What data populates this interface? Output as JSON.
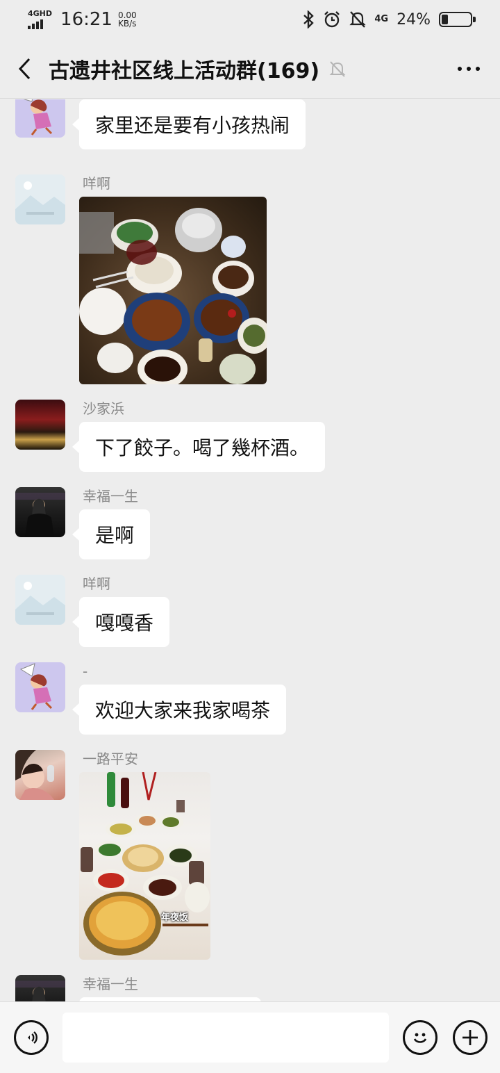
{
  "status_bar": {
    "network": "4GHD",
    "time": "16:21",
    "speed_value": "0.00",
    "speed_unit": "KB/s",
    "cell": "4G",
    "battery_text": "24%",
    "battery_level": 0.24
  },
  "header": {
    "title": "古遗井社区线上活动群(169)"
  },
  "messages": [
    {
      "type": "text",
      "sender": "",
      "text": "家里还是要有小孩热闹",
      "avatar": "cartoon-avatar"
    },
    {
      "type": "image",
      "sender": "咩啊",
      "image": "dinner-table-photo",
      "avatar": "placeholder-avatar"
    },
    {
      "type": "text",
      "sender": "沙家浜",
      "text": "下了餃子。喝了幾杯酒。",
      "avatar": "night-scene-avatar"
    },
    {
      "type": "text",
      "sender": "幸福一生",
      "text": "是啊",
      "avatar": "night-person-avatar"
    },
    {
      "type": "text",
      "sender": "咩啊",
      "text": "嘎嘎香",
      "avatar": "placeholder-avatar"
    },
    {
      "type": "text",
      "sender": "-",
      "text": "欢迎大家来我家喝茶",
      "avatar": "cartoon-avatar"
    },
    {
      "type": "image",
      "sender": "一路平安",
      "image": "new-year-dinner-photo",
      "image_caption": "年夜饭",
      "avatar": "child-avatar"
    },
    {
      "type": "text",
      "sender": "幸福一生",
      "text": "",
      "avatar": "night-person-avatar"
    }
  ],
  "input": {
    "placeholder": ""
  },
  "colors": {
    "background": "#ededed",
    "bubble": "#ffffff",
    "sender_name": "#8a8a8a",
    "input_bar": "#f6f6f6"
  }
}
